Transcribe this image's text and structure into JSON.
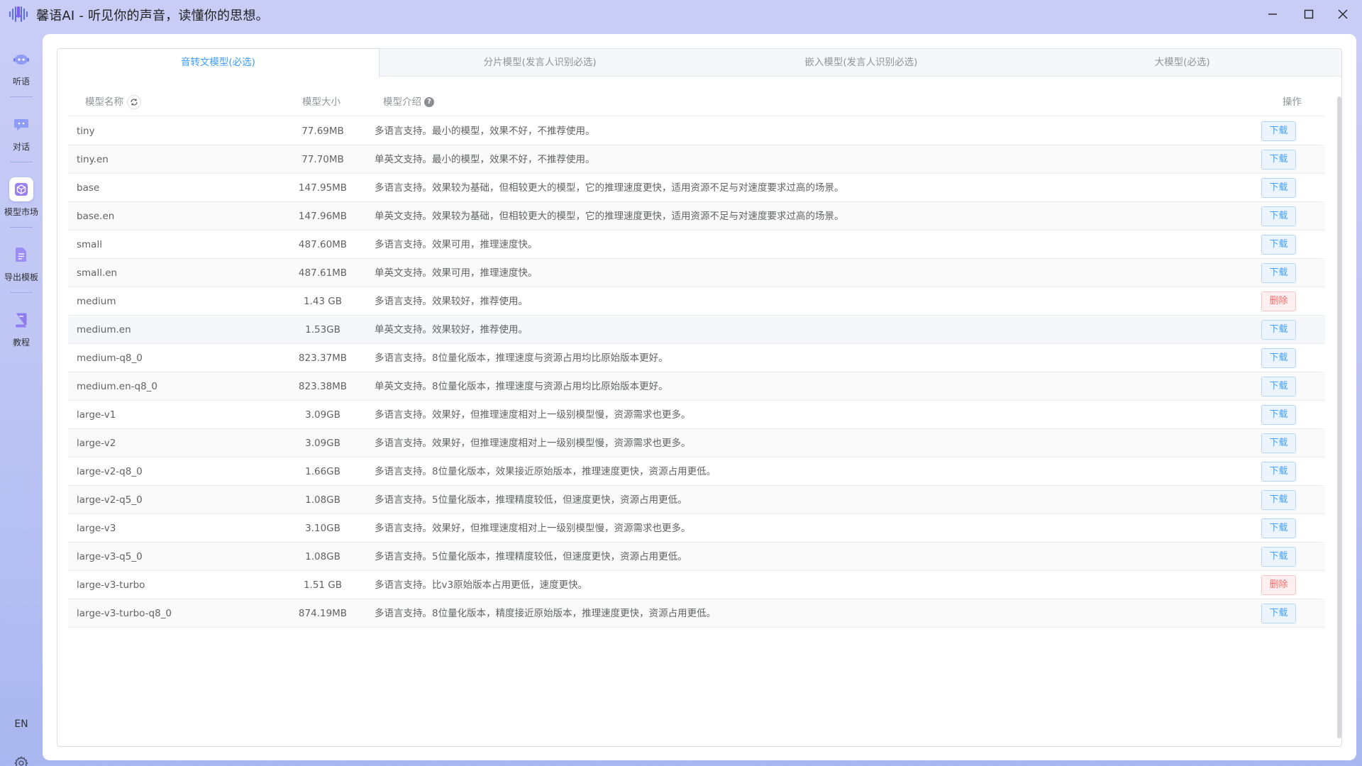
{
  "window": {
    "title": "馨语AI - 听见你的声音，读懂你的思想。",
    "minimize_icon": "minimize-icon",
    "maximize_icon": "maximize-icon",
    "close_icon": "close-icon"
  },
  "sidebar": {
    "items": [
      {
        "label": "听语",
        "icon": "listen-robot-icon"
      },
      {
        "label": "对话",
        "icon": "chat-bubble-icon"
      },
      {
        "label": "模型市场",
        "icon": "model-cube-icon",
        "active": true
      },
      {
        "label": "导出模板",
        "icon": "document-icon"
      },
      {
        "label": "教程",
        "icon": "book-icon"
      }
    ],
    "language_toggle": "EN",
    "settings_icon": "gear-icon"
  },
  "tabs": [
    {
      "label": "音转文模型(必选)",
      "active": true
    },
    {
      "label": "分片模型(发言人识别必选)"
    },
    {
      "label": "嵌入模型(发言人识别必选)"
    },
    {
      "label": "大模型(必选)"
    }
  ],
  "table": {
    "headers": {
      "name": "模型名称",
      "size": "模型大小",
      "description": "模型介绍",
      "operation": "操作"
    },
    "rows": [
      {
        "name": "tiny",
        "size": "77.69MB",
        "description": "多语言支持。最小的模型，效果不好，不推荐使用。",
        "action": "下载"
      },
      {
        "name": "tiny.en",
        "size": "77.70MB",
        "description": "单英文支持。最小的模型，效果不好，不推荐使用。",
        "action": "下载"
      },
      {
        "name": "base",
        "size": "147.95MB",
        "description": "多语言支持。效果较为基础，但相较更大的模型，它的推理速度更快，适用资源不足与对速度要求过高的场景。",
        "action": "下载"
      },
      {
        "name": "base.en",
        "size": "147.96MB",
        "description": "单英文支持。效果较为基础，但相较更大的模型，它的推理速度更快，适用资源不足与对速度要求过高的场景。",
        "action": "下载"
      },
      {
        "name": "small",
        "size": "487.60MB",
        "description": "多语言支持。效果可用，推理速度快。",
        "action": "下载"
      },
      {
        "name": "small.en",
        "size": "487.61MB",
        "description": "单英文支持。效果可用，推理速度快。",
        "action": "下载"
      },
      {
        "name": "medium",
        "size": "1.43 GB",
        "description": "多语言支持。效果较好，推荐使用。",
        "action": "删除"
      },
      {
        "name": "medium.en",
        "size": "1.53GB",
        "description": "单英文支持。效果较好，推荐使用。",
        "action": "下载"
      },
      {
        "name": "medium-q8_0",
        "size": "823.37MB",
        "description": "多语言支持。8位量化版本，推理速度与资源占用均比原始版本更好。",
        "action": "下载"
      },
      {
        "name": "medium.en-q8_0",
        "size": "823.38MB",
        "description": "单英文支持。8位量化版本，推理速度与资源占用均比原始版本更好。",
        "action": "下载"
      },
      {
        "name": "large-v1",
        "size": "3.09GB",
        "description": "多语言支持。效果好，但推理速度相对上一级别模型慢，资源需求也更多。",
        "action": "下载"
      },
      {
        "name": "large-v2",
        "size": "3.09GB",
        "description": "多语言支持。效果好，但推理速度相对上一级别模型慢，资源需求也更多。",
        "action": "下载"
      },
      {
        "name": "large-v2-q8_0",
        "size": "1.66GB",
        "description": "多语言支持。8位量化版本，效果接近原始版本，推理速度更快，资源占用更低。",
        "action": "下载"
      },
      {
        "name": "large-v2-q5_0",
        "size": "1.08GB",
        "description": "多语言支持。5位量化版本，推理精度较低，但速度更快，资源占用更低。",
        "action": "下载"
      },
      {
        "name": "large-v3",
        "size": "3.10GB",
        "description": "多语言支持。效果好，但推理速度相对上一级别模型慢，资源需求也更多。",
        "action": "下载"
      },
      {
        "name": "large-v3-q5_0",
        "size": "1.08GB",
        "description": "多语言支持。5位量化版本，推理精度较低，但速度更快，资源占用更低。",
        "action": "下载"
      },
      {
        "name": "large-v3-turbo",
        "size": "1.51 GB",
        "description": "多语言支持。比v3原始版本占用更低，速度更快。",
        "action": "删除"
      },
      {
        "name": "large-v3-turbo-q8_0",
        "size": "874.19MB",
        "description": "多语言支持。8位量化版本，精度接近原始版本，推理速度更快，资源占用更低。",
        "action": "下载"
      }
    ]
  },
  "colors": {
    "accent": "#409eff",
    "danger": "#f56c6c",
    "background_gradient": [
      "#c9cdf6",
      "#a9b7f0"
    ]
  }
}
